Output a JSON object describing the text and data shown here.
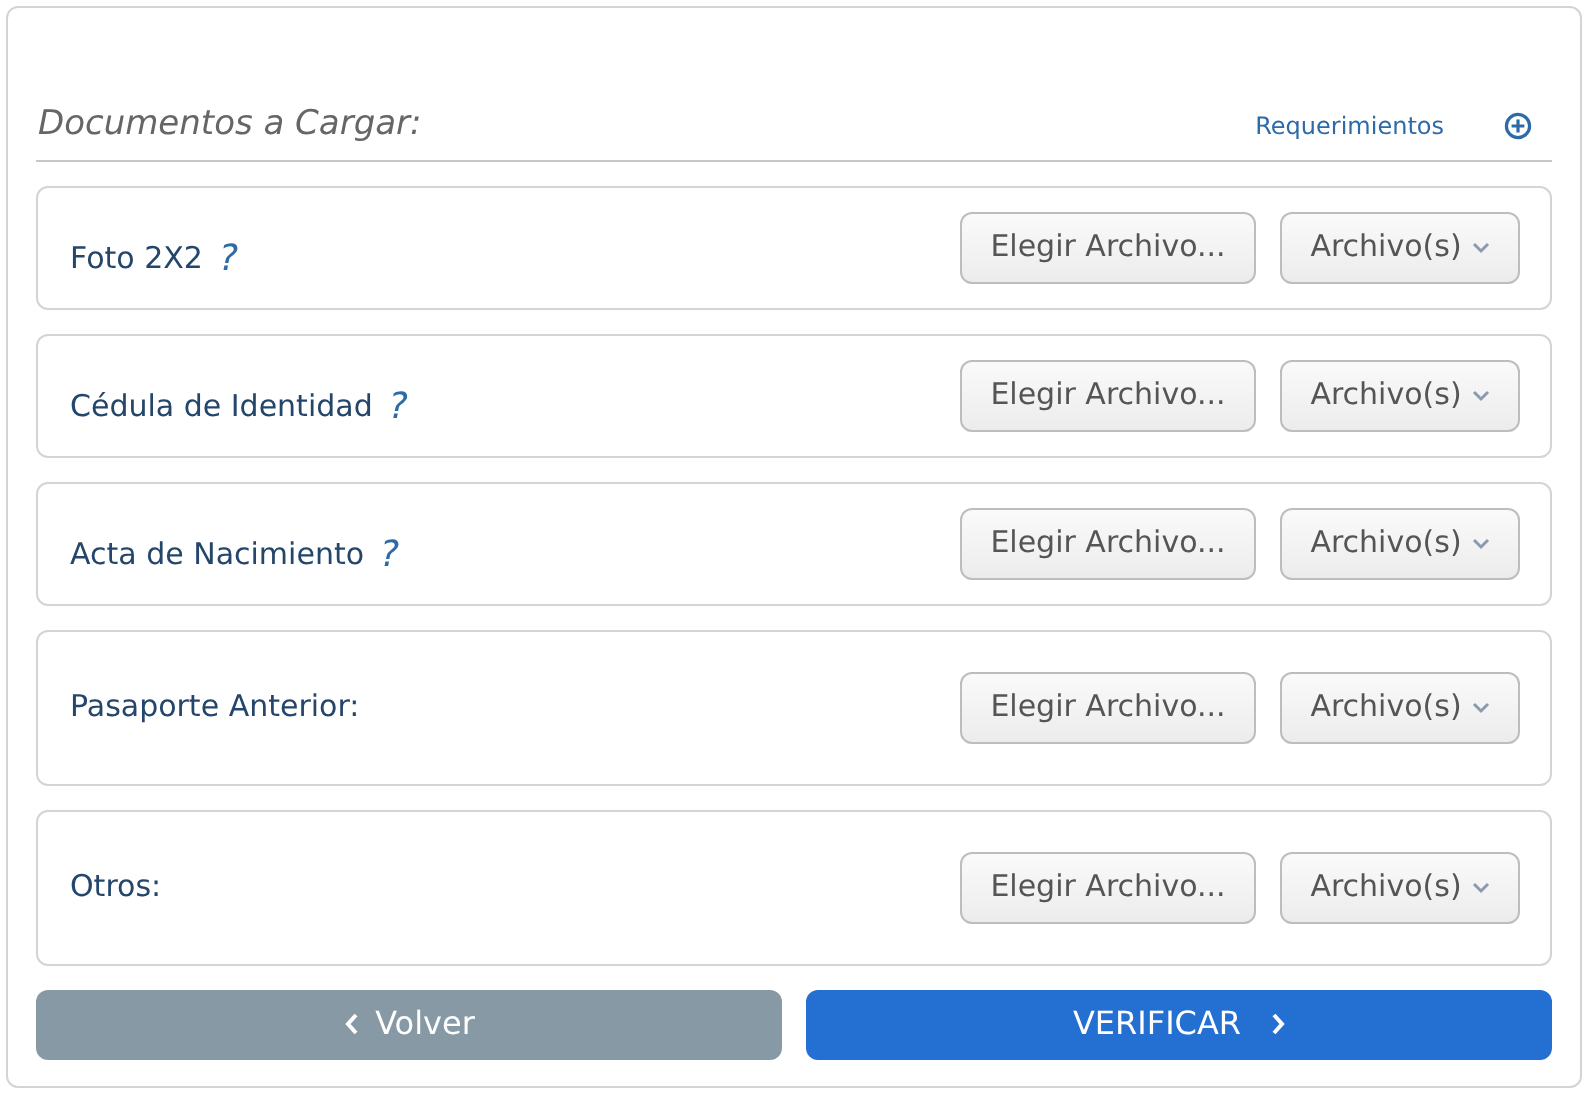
{
  "section": {
    "title": "Documentos a Cargar:",
    "link": "Requerimientos"
  },
  "documents": [
    {
      "label": "Foto 2X2",
      "help": "?",
      "choose": "Elegir Archivo...",
      "files": "Archivo(s)"
    },
    {
      "label": "Cédula de Identidad",
      "help": "?",
      "choose": "Elegir Archivo...",
      "files": "Archivo(s)"
    },
    {
      "label": "Acta de Nacimiento",
      "help": "?",
      "choose": "Elegir Archivo...",
      "files": "Archivo(s)"
    },
    {
      "label": "Pasaporte Anterior:",
      "choose": "Elegir Archivo...",
      "files": "Archivo(s)"
    },
    {
      "label": "Otros:",
      "choose": "Elegir Archivo...",
      "files": "Archivo(s)"
    }
  ],
  "buttons": {
    "back": "Volver",
    "next": "VERIFICAR"
  }
}
